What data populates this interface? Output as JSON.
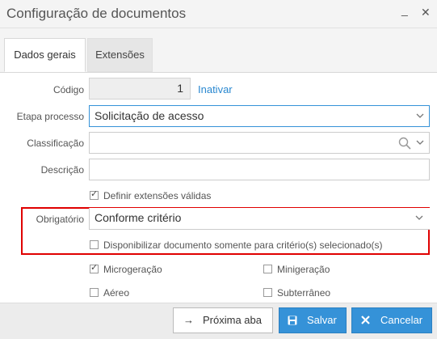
{
  "window": {
    "title": "Configuração de documentos",
    "minimize_label": "_",
    "close_label": "✕"
  },
  "tabs": [
    {
      "label": "Dados gerais",
      "active": true
    },
    {
      "label": "Extensões",
      "active": false
    }
  ],
  "form": {
    "codigo": {
      "label": "Código",
      "value": "1",
      "action": "Inativar"
    },
    "etapa": {
      "label": "Etapa processo",
      "value": "Solicitação de acesso"
    },
    "classificacao": {
      "label": "Classificação",
      "value": ""
    },
    "descricao": {
      "label": "Descrição",
      "value": ""
    },
    "definir_extensoes": {
      "label": "Definir extensões válidas",
      "checked": true
    },
    "obrigatorio": {
      "label": "Obrigatório",
      "value": "Conforme critério"
    },
    "disponibilizar": {
      "label": "Disponibilizar documento somente para critério(s) selecionado(s)",
      "checked": false
    },
    "options": [
      {
        "label": "Microgeração",
        "checked": true
      },
      {
        "label": "Minigeração",
        "checked": false
      },
      {
        "label": "Aéreo",
        "checked": false
      },
      {
        "label": "Subterrâneo",
        "checked": false
      }
    ]
  },
  "footer": {
    "next_label": "Próxima aba",
    "save_label": "Salvar",
    "cancel_label": "Cancelar"
  },
  "colors": {
    "accent": "#3592d8",
    "highlight": "#e00000",
    "link": "#2a88d0"
  }
}
